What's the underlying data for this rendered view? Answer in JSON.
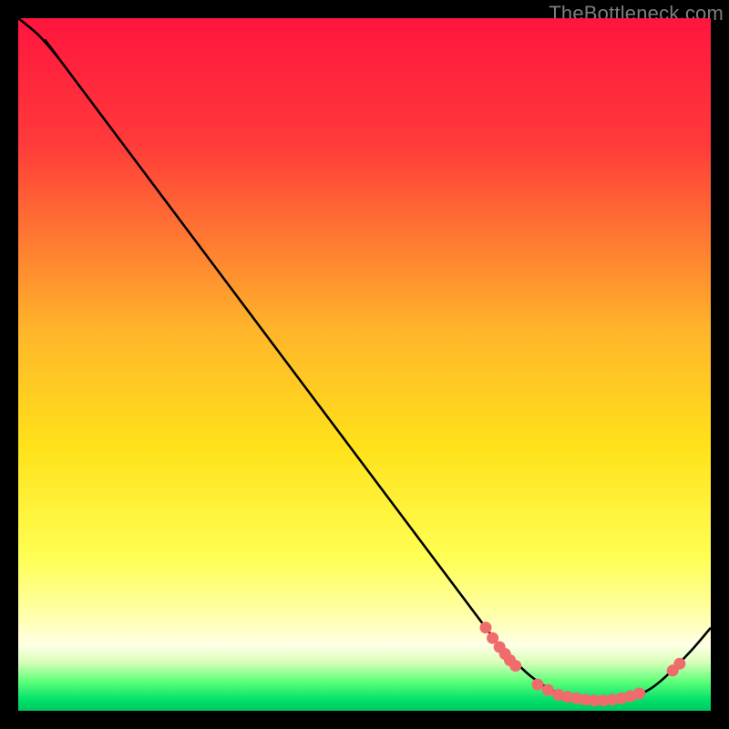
{
  "watermark": "TheBottleneck.com",
  "chart_data": {
    "type": "line",
    "title": "",
    "xlabel": "",
    "ylabel": "",
    "xlim": [
      0,
      100
    ],
    "ylim": [
      0,
      100
    ],
    "gradient_stops": [
      {
        "offset": 0,
        "color": "#ff153e"
      },
      {
        "offset": 0.18,
        "color": "#ff3a3a"
      },
      {
        "offset": 0.45,
        "color": "#ffb52a"
      },
      {
        "offset": 0.62,
        "color": "#ffe21a"
      },
      {
        "offset": 0.78,
        "color": "#ffff55"
      },
      {
        "offset": 0.86,
        "color": "#ffffa8"
      },
      {
        "offset": 0.905,
        "color": "#ffffe6"
      },
      {
        "offset": 0.93,
        "color": "#d8ffb8"
      },
      {
        "offset": 0.958,
        "color": "#5cff78"
      },
      {
        "offset": 0.985,
        "color": "#00e06a"
      },
      {
        "offset": 1.0,
        "color": "#00c85e"
      }
    ],
    "curve": [
      {
        "x": 0.0,
        "y": 100.0
      },
      {
        "x": 3.0,
        "y": 97.5
      },
      {
        "x": 6.0,
        "y": 94.0
      },
      {
        "x": 9.0,
        "y": 90.0
      },
      {
        "x": 66.0,
        "y": 14.0
      },
      {
        "x": 70.0,
        "y": 9.0
      },
      {
        "x": 74.0,
        "y": 5.0
      },
      {
        "x": 78.0,
        "y": 2.5
      },
      {
        "x": 82.0,
        "y": 1.5
      },
      {
        "x": 86.0,
        "y": 1.5
      },
      {
        "x": 90.0,
        "y": 2.5
      },
      {
        "x": 93.0,
        "y": 4.5
      },
      {
        "x": 97.0,
        "y": 8.5
      },
      {
        "x": 100.0,
        "y": 12.0
      }
    ],
    "markers": [
      {
        "x": 67.5,
        "y": 12.0
      },
      {
        "x": 68.5,
        "y": 10.5
      },
      {
        "x": 69.5,
        "y": 9.2
      },
      {
        "x": 70.3,
        "y": 8.2
      },
      {
        "x": 71.0,
        "y": 7.3
      },
      {
        "x": 71.8,
        "y": 6.5
      },
      {
        "x": 75.0,
        "y": 3.8
      },
      {
        "x": 76.5,
        "y": 3.0
      },
      {
        "x": 78.0,
        "y": 2.3
      },
      {
        "x": 79.3,
        "y": 2.0
      },
      {
        "x": 80.6,
        "y": 1.8
      },
      {
        "x": 81.9,
        "y": 1.6
      },
      {
        "x": 83.2,
        "y": 1.5
      },
      {
        "x": 84.5,
        "y": 1.5
      },
      {
        "x": 85.8,
        "y": 1.6
      },
      {
        "x": 87.1,
        "y": 1.8
      },
      {
        "x": 88.4,
        "y": 2.1
      },
      {
        "x": 89.7,
        "y": 2.5
      },
      {
        "x": 94.5,
        "y": 5.8
      },
      {
        "x": 95.5,
        "y": 6.8
      }
    ],
    "marker_color": "#f06b6b",
    "curve_color": "#000000"
  }
}
